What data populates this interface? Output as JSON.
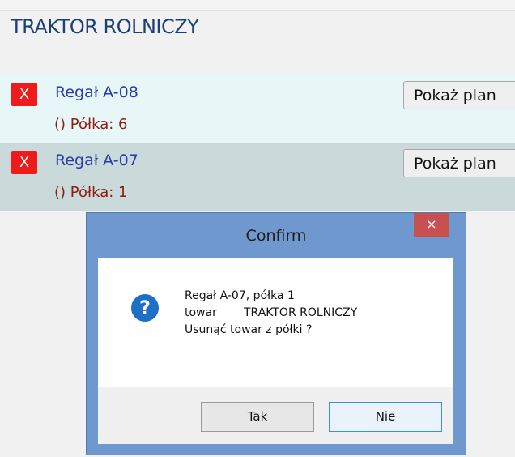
{
  "page": {
    "title": "TRAKTOR ROLNICZY"
  },
  "rows": [
    {
      "delete_label": "X",
      "rack": "Regał A-08",
      "shelf": "() Półka: 6",
      "plan_button": "Pokaż plan"
    },
    {
      "delete_label": "X",
      "rack": "Regał A-07",
      "shelf": "() Półka: 1",
      "plan_button": "Pokaż plan"
    }
  ],
  "dialog": {
    "title": "Confirm",
    "close_label": "×",
    "icon_glyph": "?",
    "line1": "Regał A-07, półka 1",
    "line2_label": "towar",
    "line2_value": "TRAKTOR ROLNICZY",
    "line3": "Usunąć towar z półki ?",
    "yes_label": "Tak",
    "no_label": "Nie"
  },
  "colors": {
    "row_highlight": "#e7f6f6",
    "row_selected": "#cad9d9",
    "delete_red": "#ee1b1b",
    "dialog_frame": "#6f98cf",
    "question_icon": "#1e6fc8"
  }
}
